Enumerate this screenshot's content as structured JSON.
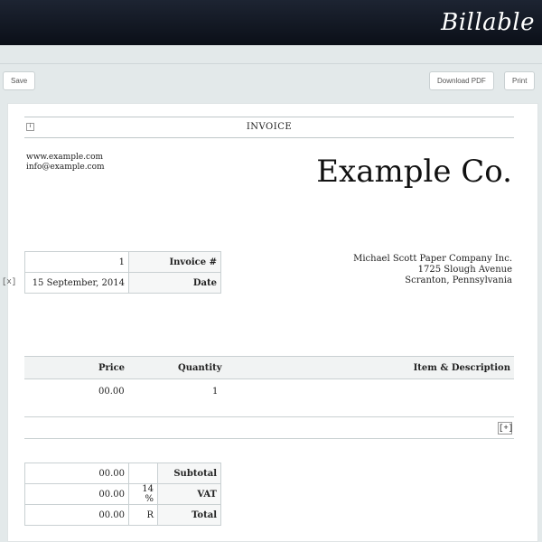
{
  "app": {
    "logo_text": "Billable"
  },
  "toolbar": {
    "save_label": "Save",
    "download_label": "Download PDF",
    "print_label": "Print"
  },
  "invoice": {
    "header_title": "INVOICE",
    "header_box": "i",
    "company_name": "Example Co.",
    "contact": {
      "website": "www.example.com",
      "email": "info@example.com"
    },
    "meta": {
      "invoice_label": "Invoice #",
      "invoice_value": "1",
      "date_label": "Date",
      "date_value": "15 September, 2014"
    },
    "address": {
      "line1": "Michael Scott Paper Company Inc.",
      "line2": "1725 Slough Avenue",
      "line3": "Scranton, Pennsylvania"
    },
    "items": {
      "headers": {
        "description": "Item & Description",
        "quantity": "Quantity",
        "price": "Price"
      },
      "rows": [
        {
          "description": "",
          "quantity": "1",
          "price": "00.00"
        }
      ],
      "delete_label": "[x]",
      "add_label": "[+]"
    },
    "totals": {
      "subtotal_label": "Subtotal",
      "subtotal_value": "00.00",
      "vat_label": "VAT",
      "vat_rate": "14 %",
      "vat_value": "00.00",
      "total_label": "Total",
      "total_currency": "R",
      "total_value": "00.00"
    }
  },
  "colors": {
    "topbar": "#0f1520",
    "background": "#e3e9ea",
    "paper": "#ffffff",
    "border": "#c9d0d2"
  }
}
